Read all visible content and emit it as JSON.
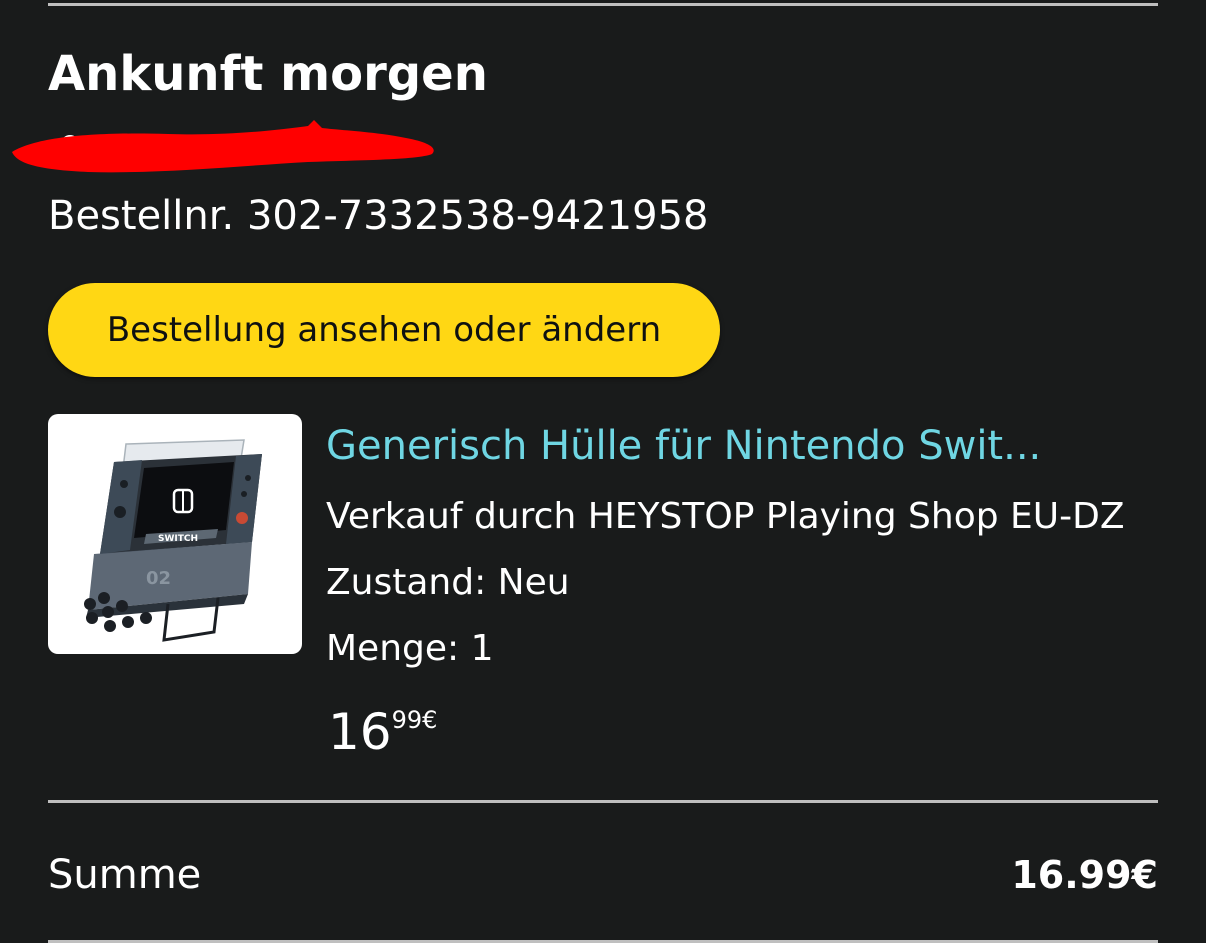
{
  "delivery": {
    "heading": "Ankunft morgen"
  },
  "order": {
    "number_label": "Bestellnr.",
    "number": "302-7332538-9421958",
    "view_button_label": "Bestellung ansehen oder ändern"
  },
  "item": {
    "title": "Generisch Hülle für Nintendo Swit...",
    "seller": "Verkauf durch HEYSTOP Playing Shop EU-DZ",
    "condition_label": "Zustand:",
    "condition": "Neu",
    "quantity_label": "Menge:",
    "quantity": "1",
    "price_whole": "16",
    "price_fraction": "99",
    "price_currency": "€",
    "image_text": "SWITCH"
  },
  "summary": {
    "label": "Summe",
    "value": "16.99€"
  },
  "colors": {
    "background": "#191b1b",
    "button": "#ffd714",
    "link": "#6fd6e3",
    "redaction": "#ff0000"
  }
}
